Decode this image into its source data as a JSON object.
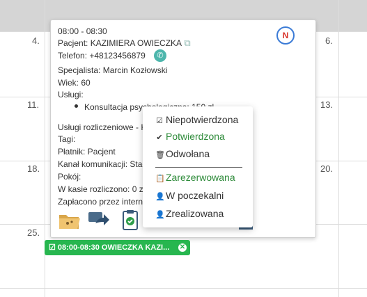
{
  "calendar": {
    "days": [
      {
        "label": "4."
      },
      {
        "label": "6."
      },
      {
        "label": "11."
      },
      {
        "label": "13."
      },
      {
        "label": "18."
      },
      {
        "label": "20."
      },
      {
        "label": "25."
      }
    ]
  },
  "popup": {
    "time": "08:00 - 08:30",
    "patient": "Pacjent: KAZIMIERA OWIECZKA",
    "phone": "Telefon: +48123456879",
    "specialist": "Specjalista: Marcin Kozłowski",
    "age": "Wiek: 60",
    "services_label": "Usługi:",
    "service_item": "Konsultacja psychologiczna: 150 zł",
    "settled_services": "Usługi rozliczeniowe - Konsultacja",
    "tags": "Tagi:",
    "payer": "Płatnik: Pacjent",
    "channel": "Kanał komunikacji: Stacjonarnie",
    "room": "Pokój:",
    "cash_settled": "W kasie rozliczono: 0 zł",
    "paid_online": "Zapłacono przez internet: 0 zł",
    "badge": "N",
    "icons": {
      "copy": "copy-icon",
      "phone": "phone-icon"
    },
    "actions": [
      "folder-icon",
      "share-icon",
      "clipboard-check-icon"
    ]
  },
  "status_menu": {
    "items": [
      {
        "label": "Niepotwierdzona",
        "icon": "☑",
        "color": "#333333"
      },
      {
        "label": "Potwierdzona",
        "icon": "✔",
        "color": "#2e8b3a"
      },
      {
        "label": "Odwołana",
        "icon": "🗑",
        "color": "#333333"
      },
      {
        "label": "Zarezerwowana",
        "icon": "📋",
        "color": "#2e8b3a"
      },
      {
        "label": "W poczekalni",
        "icon": "👤",
        "color": "#333333"
      },
      {
        "label": "Zrealizowana",
        "icon": "👤",
        "color": "#333333"
      }
    ]
  },
  "event_chip": {
    "label": "08:00-08:30 OWIECZKA KAZI...",
    "color": "#27b64f"
  }
}
